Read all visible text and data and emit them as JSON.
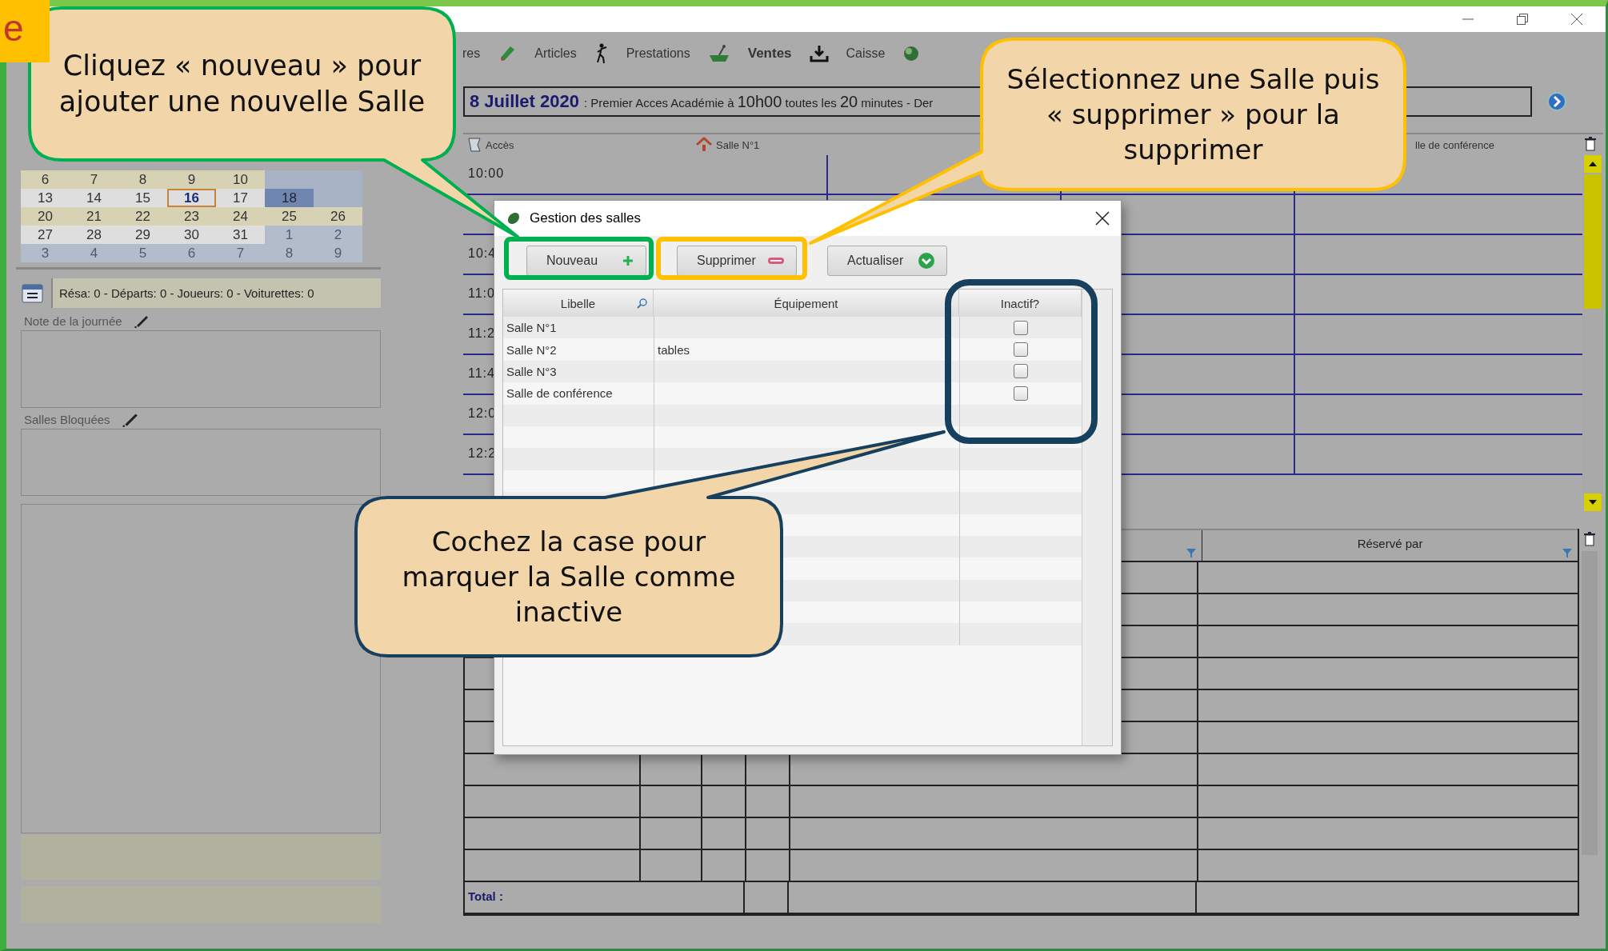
{
  "corner_tag": "e",
  "toolbar": {
    "items": [
      {
        "label": "res",
        "bold": false
      },
      {
        "label": "Articles",
        "bold": false
      },
      {
        "label": "Prestations",
        "bold": false
      },
      {
        "label": "Ventes",
        "bold": true
      },
      {
        "label": "Caisse",
        "bold": false
      }
    ]
  },
  "banner": {
    "date": "8 Juillet 2020",
    "text": ": Premier Acces Académie à **10h00** toutes les **20** minutes - Der"
  },
  "calendar": {
    "weeks": [
      [
        {
          "day": "6",
          "other_month": false,
          "selected": false,
          "highlighted": false
        },
        {
          "day": "7",
          "other_month": false,
          "selected": false,
          "highlighted": false
        },
        {
          "day": "8",
          "other_month": false,
          "selected": false,
          "highlighted": false
        },
        {
          "day": "9",
          "other_month": false,
          "selected": false,
          "highlighted": false
        },
        {
          "day": "10",
          "other_month": false,
          "selected": false,
          "highlighted": false
        }
      ],
      [
        {
          "day": "13",
          "other_month": false,
          "selected": false,
          "highlighted": false
        },
        {
          "day": "14",
          "other_month": false,
          "selected": false,
          "highlighted": false
        },
        {
          "day": "15",
          "other_month": false,
          "selected": false,
          "highlighted": false
        },
        {
          "day": "16",
          "other_month": false,
          "selected": true,
          "highlighted": false
        },
        {
          "day": "17",
          "other_month": false,
          "selected": false,
          "highlighted": false
        },
        {
          "day": "18",
          "other_month": false,
          "selected": false,
          "highlighted": true
        }
      ],
      [
        {
          "day": "20",
          "other_month": false,
          "selected": false,
          "highlighted": false
        },
        {
          "day": "21",
          "other_month": false,
          "selected": false,
          "highlighted": false
        },
        {
          "day": "22",
          "other_month": false,
          "selected": false,
          "highlighted": false
        },
        {
          "day": "23",
          "other_month": false,
          "selected": false,
          "highlighted": false
        },
        {
          "day": "24",
          "other_month": false,
          "selected": false,
          "highlighted": false
        },
        {
          "day": "25",
          "other_month": false,
          "selected": false,
          "highlighted": false
        },
        {
          "day": "26",
          "other_month": false,
          "selected": false,
          "highlighted": false
        }
      ],
      [
        {
          "day": "27",
          "other_month": false,
          "selected": false,
          "highlighted": false
        },
        {
          "day": "28",
          "other_month": false,
          "selected": false,
          "highlighted": false
        },
        {
          "day": "29",
          "other_month": false,
          "selected": false,
          "highlighted": false
        },
        {
          "day": "30",
          "other_month": false,
          "selected": false,
          "highlighted": false
        },
        {
          "day": "31",
          "other_month": false,
          "selected": false,
          "highlighted": false
        },
        {
          "day": "1",
          "other_month": true,
          "selected": false,
          "highlighted": false
        },
        {
          "day": "2",
          "other_month": true,
          "selected": false,
          "highlighted": false
        }
      ],
      [
        {
          "day": "3",
          "other_month": true,
          "selected": false,
          "highlighted": false
        },
        {
          "day": "4",
          "other_month": true,
          "selected": false,
          "highlighted": false
        },
        {
          "day": "5",
          "other_month": true,
          "selected": false,
          "highlighted": false
        },
        {
          "day": "6",
          "other_month": true,
          "selected": false,
          "highlighted": false
        },
        {
          "day": "7",
          "other_month": true,
          "selected": false,
          "highlighted": false
        },
        {
          "day": "8",
          "other_month": true,
          "selected": false,
          "highlighted": false
        },
        {
          "day": "9",
          "other_month": true,
          "selected": false,
          "highlighted": false
        }
      ]
    ]
  },
  "day_summary": "Résa: 0 - Départs: 0 - Joueurs: 0 - Voiturettes: 0",
  "note_group": {
    "label": "Note de la journée"
  },
  "blocked_group": {
    "label": "Salles Bloquées"
  },
  "schedule": {
    "columns": [
      "Accès",
      "Salle N°1",
      "lle de conférence"
    ],
    "rows": [
      {
        "time": "10:00"
      },
      {},
      {
        "time": "10:4"
      },
      {
        "time": "11:0"
      },
      {
        "time": "11:2"
      },
      {
        "time": "11:4"
      },
      {
        "time": "12:0"
      },
      {
        "time": "12:2"
      }
    ]
  },
  "bookings": {
    "column_header": "Réservé par",
    "total_label": "Total :"
  },
  "dialog": {
    "title": "Gestion des salles",
    "buttons": [
      {
        "label": "Nouveau",
        "kind": "add"
      },
      {
        "label": "Supprimer",
        "kind": "delete"
      },
      {
        "label": "Actualiser",
        "kind": "refresh"
      }
    ],
    "columns": [
      "Libelle",
      "Équipement",
      "Inactif?"
    ],
    "rows": [
      {
        "name": "Salle N°1",
        "inactive": false
      },
      {
        "name": "Salle N°2",
        "equipment": "tables",
        "inactive": false
      },
      {
        "name": "Salle N°3",
        "inactive": false
      },
      {
        "name": "Salle de conférence",
        "inactive": false
      }
    ]
  },
  "callouts": [
    {
      "text": "Cliquez « nouveau » pour ajouter une nouvelle Salle",
      "color": "#00b050"
    },
    {
      "text": "Sélectionnez une Salle puis « supprimer » pour la supprimer",
      "color": "#ffc000"
    },
    {
      "text": "Cochez la case pour marquer la Salle comme inactive",
      "color": "#17405e"
    }
  ]
}
